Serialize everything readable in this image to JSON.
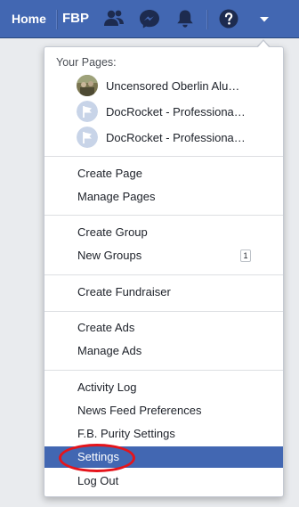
{
  "topbar": {
    "home_label": "Home",
    "fbp_label": "FBP",
    "icons": [
      "friend-requests-icon",
      "messenger-icon",
      "notifications-icon",
      "help-icon",
      "dropdown-arrow-icon"
    ],
    "bg_color": "#4267b2"
  },
  "menu": {
    "your_pages_heading": "Your Pages:",
    "pages": [
      {
        "name": "Uncensored Oberlin Alu…",
        "avatar": "photo-avatar"
      },
      {
        "name": "DocRocket - Professiona…",
        "avatar": "flag-avatar"
      },
      {
        "name": "DocRocket - Professiona…",
        "avatar": "flag-avatar"
      }
    ],
    "items": {
      "create_page": "Create Page",
      "manage_pages": "Manage Pages",
      "create_group": "Create Group",
      "new_groups": "New Groups",
      "new_groups_count": "1",
      "create_fundraiser": "Create Fundraiser",
      "create_ads": "Create Ads",
      "manage_ads": "Manage Ads",
      "activity_log": "Activity Log",
      "news_feed_preferences": "News Feed Preferences",
      "fb_purity_settings": "F.B. Purity Settings",
      "settings": "Settings",
      "log_out": "Log Out"
    },
    "selected_color": "#4267b2",
    "annotation_color": "#e5141b"
  }
}
